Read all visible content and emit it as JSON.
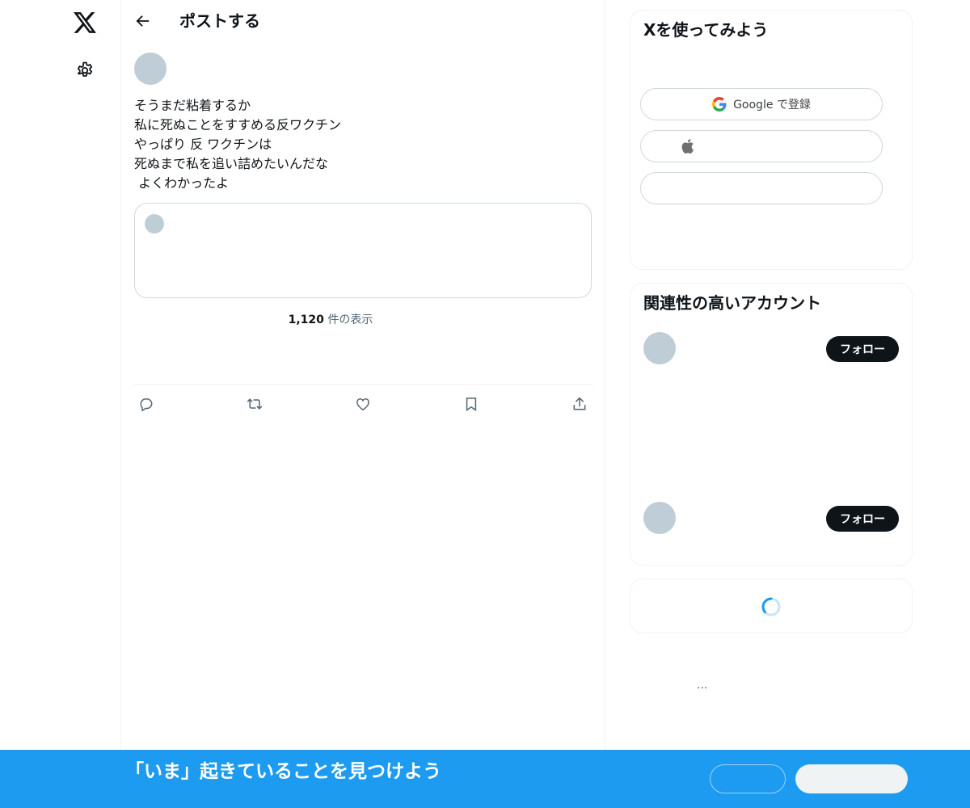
{
  "header": {
    "title": "ポストする"
  },
  "post": {
    "text": "そうまだ粘着するか\n私に死ぬことをすすめる反ワクチン\nやっぱり 反 ワクチンは\n死ぬまで私を追い詰めたいんだな\n よくわかったよ",
    "views_count": "1,120",
    "views_label": " 件の表示"
  },
  "icons": {
    "logo": "x-logo-icon",
    "settings": "gear-icon",
    "back": "arrow-left-icon",
    "reply": "reply-icon",
    "repost": "repost-icon",
    "like": "heart-icon",
    "bookmark": "bookmark-icon",
    "share": "share-icon",
    "google": "google-icon",
    "apple": "apple-icon",
    "spinner": "loading-spinner-icon"
  },
  "sidebar": {
    "signup_title": "Xを使ってみよう",
    "google_label": "Google で登録",
    "who_title": "関連性の高いアカウント",
    "follow_label": "フォロー",
    "more": "..."
  },
  "bottom_bar": {
    "text": "「いま」起きていることを見つけよう"
  },
  "colors": {
    "brand": "#1d9bf0",
    "text": "#0f1419",
    "muted": "#536471",
    "avatar": "#bfcdd7"
  }
}
